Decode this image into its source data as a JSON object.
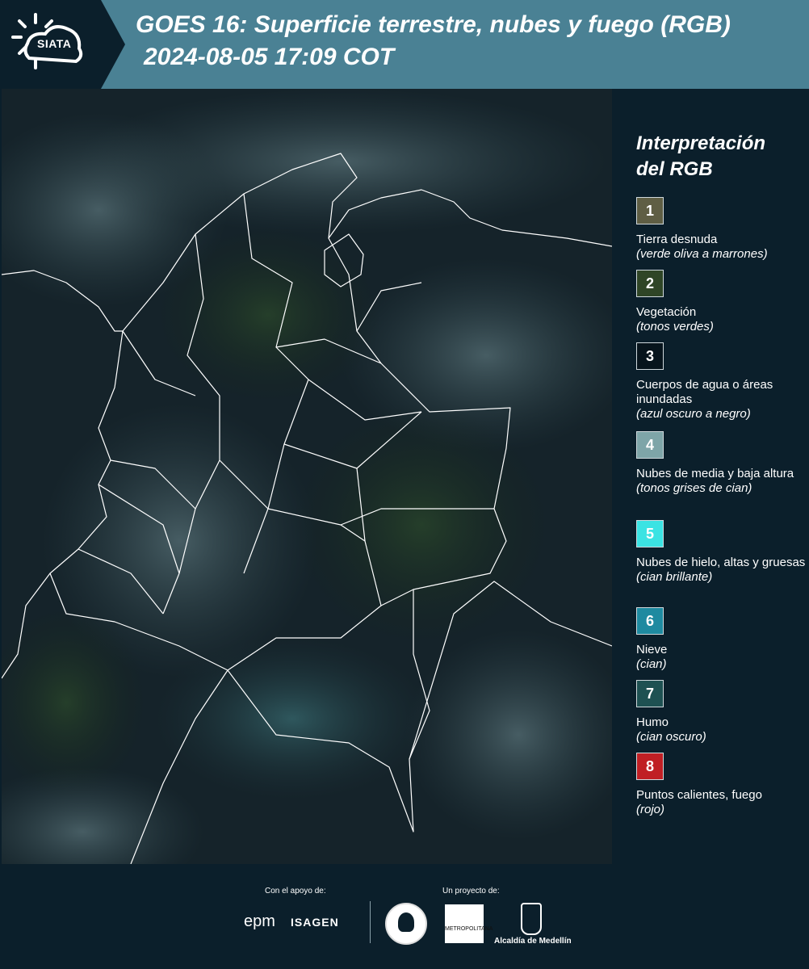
{
  "header": {
    "logo": "SIATA",
    "title": "GOES 16: Superficie terrestre, nubes y fuego (RGB)",
    "subtitle": "2024-08-05 17:09 COT"
  },
  "legend": {
    "title": "Interpretación del RGB",
    "items": [
      {
        "num": "1",
        "label": "Tierra desnuda",
        "sub": "(verde oliva a marrones)",
        "color": "#5f5e44"
      },
      {
        "num": "2",
        "label": "Vegetación",
        "sub": "(tonos verdes)",
        "color": "#2f4526"
      },
      {
        "num": "3",
        "label": "Cuerpos de agua o áreas inundadas",
        "sub": "(azul oscuro a negro)",
        "color": "#07141c"
      },
      {
        "num": "4",
        "label": "Nubes de media y baja altura",
        "sub": "(tonos grises de cian)",
        "color": "#7ea5a8"
      },
      {
        "num": "5",
        "label": "Nubes de hielo, altas y gruesas",
        "sub": "(cian brillante)",
        "color": "#3be3e3"
      },
      {
        "num": "6",
        "label": "Nieve",
        "sub": "(cian)",
        "color": "#1e8aa0"
      },
      {
        "num": "7",
        "label": "Humo",
        "sub": "(cian oscuro)",
        "color": "#1e5152"
      },
      {
        "num": "8",
        "label": "Puntos calientes, fuego",
        "sub": "(rojo)",
        "color": "#c01f24"
      }
    ]
  },
  "footer": {
    "support_label": "Con el apoyo de:",
    "project_label": "Un proyecto de:",
    "sponsor1": "epm",
    "sponsor2": "ISAGEN",
    "partner1": "METROPOLITANA",
    "partner2": "Alcaldía de Medellín"
  }
}
